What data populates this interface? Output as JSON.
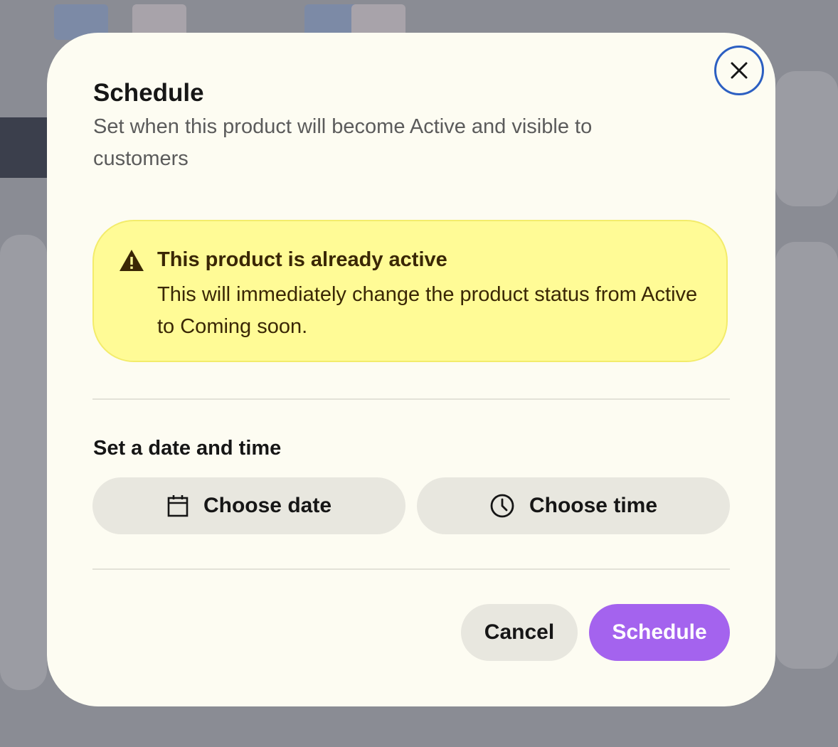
{
  "modal": {
    "title": "Schedule",
    "subtitle": "Set when this product will become Active and visible to customers",
    "close_icon": "close-icon"
  },
  "alert": {
    "icon": "warning-icon",
    "title": "This product is already active",
    "body": "This will immediately change the product status from Active to Coming soon."
  },
  "datetime": {
    "heading": "Set a date and time",
    "date_button": {
      "label": "Choose date",
      "icon": "calendar-icon"
    },
    "time_button": {
      "label": "Choose time",
      "icon": "clock-icon"
    }
  },
  "actions": {
    "cancel_label": "Cancel",
    "schedule_label": "Schedule"
  },
  "colors": {
    "modal_bg": "#fdfcf2",
    "alert_bg": "#fffb96",
    "primary": "#a463ee",
    "secondary_button": "#e8e7df",
    "focus_ring": "#2c5fc2"
  }
}
